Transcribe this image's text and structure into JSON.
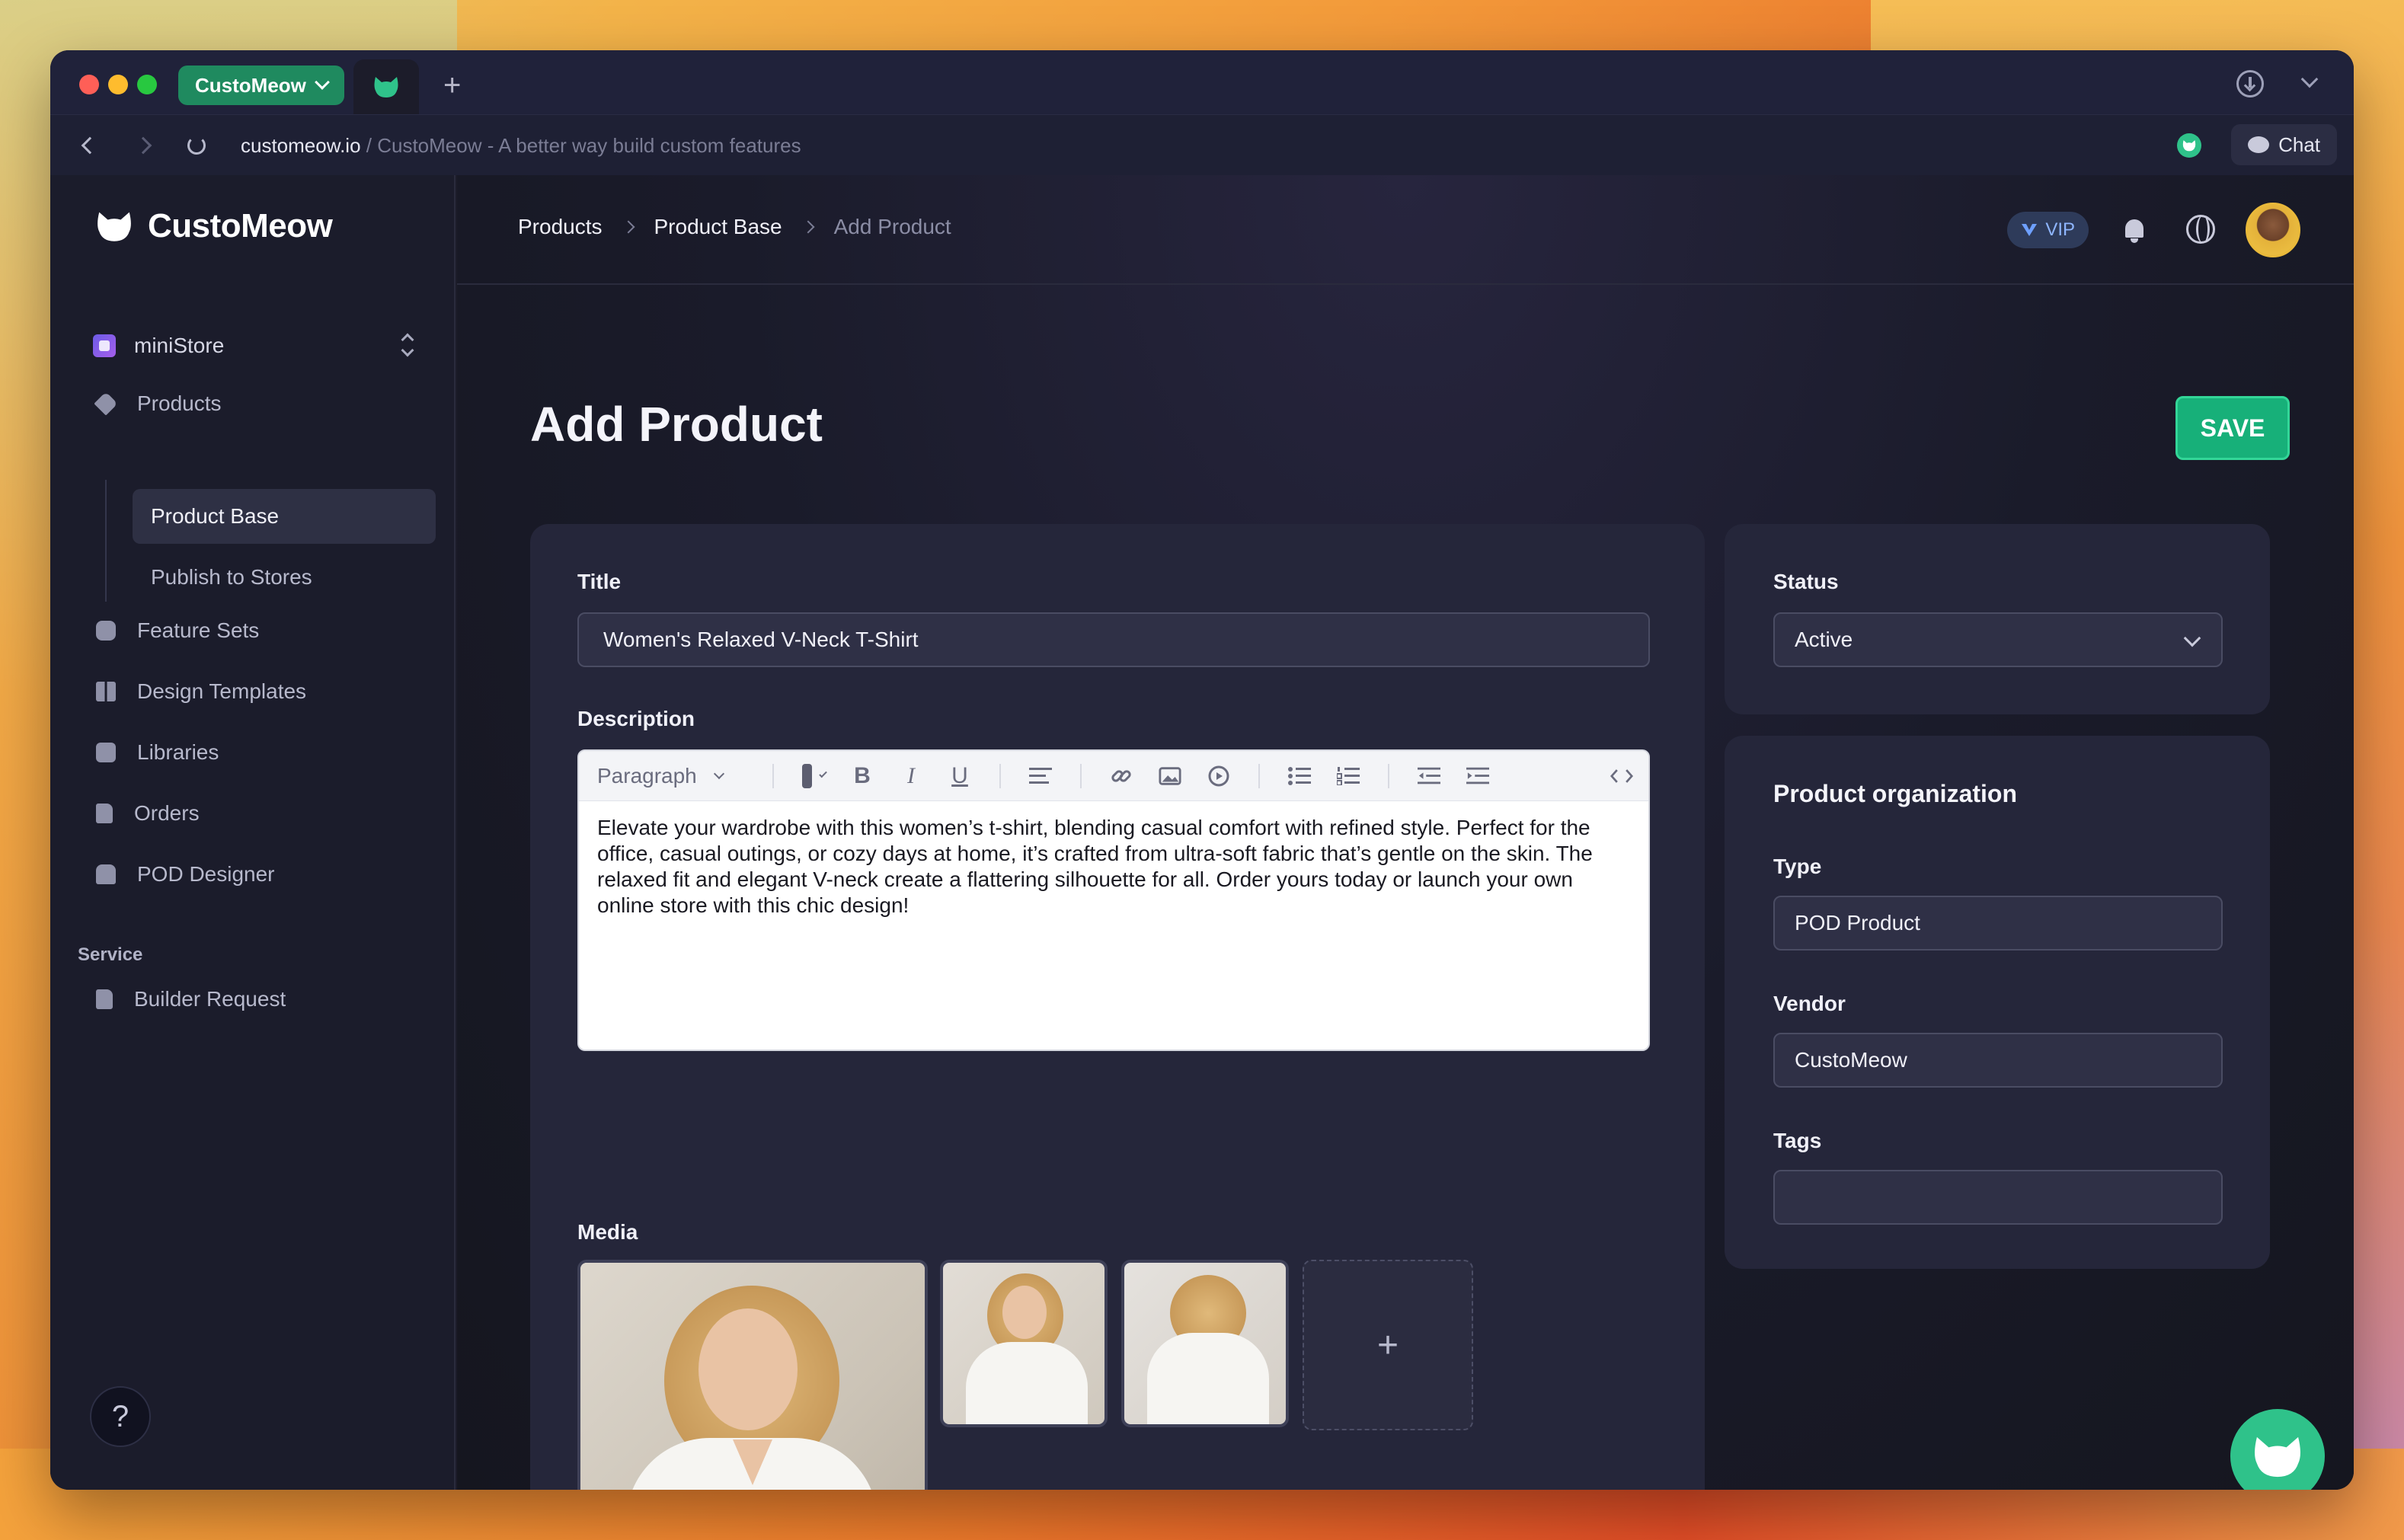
{
  "browser": {
    "app_tab_label": "CustoMeow",
    "url_domain": "customeow.io",
    "url_rest": " / CustoMeow - A better way build custom features",
    "chat_label": "Chat"
  },
  "sidebar": {
    "brand": "CustoMeow",
    "store": "miniStore",
    "items": [
      {
        "label": "Products",
        "icon": "tag-icon"
      },
      {
        "label": "Product Base",
        "icon": ""
      },
      {
        "label": "Publish to Stores",
        "icon": ""
      },
      {
        "label": "Feature Sets",
        "icon": "puzzle-icon"
      },
      {
        "label": "Design Templates",
        "icon": "grid-icon"
      },
      {
        "label": "Libraries",
        "icon": "stack-icon"
      },
      {
        "label": "Orders",
        "icon": "document-icon"
      },
      {
        "label": "POD Designer",
        "icon": "shirt-icon"
      }
    ],
    "section_service": "Service",
    "service_items": [
      {
        "label": "Builder Request",
        "icon": "request-icon"
      }
    ],
    "help": "?"
  },
  "topbar": {
    "breadcrumb": [
      "Products",
      "Product Base",
      "Add Product"
    ],
    "vip_label": "VIP"
  },
  "page": {
    "title": "Add Product",
    "save_label": "SAVE"
  },
  "form": {
    "title_label": "Title",
    "title_value": "Women's Relaxed V-Neck T-Shirt",
    "description_label": "Description",
    "toolbar_paragraph": "Paragraph",
    "description_value": "Elevate your wardrobe with this women’s t-shirt, blending casual comfort with refined style. Perfect for the office, casual outings, or cozy days at home, it’s crafted from ultra-soft fabric that’s gentle on the skin. The relaxed fit and elegant V-neck create a flattering silhouette for all. Order yours today or launch your own online store with this chic design!",
    "media_label": "Media",
    "media_add": "+"
  },
  "status_card": {
    "label": "Status",
    "value": "Active"
  },
  "org_card": {
    "title": "Product organization",
    "type_label": "Type",
    "type_value": "POD Product",
    "vendor_label": "Vendor",
    "vendor_value": "CustoMeow",
    "tags_label": "Tags",
    "tags_value": ""
  },
  "colors": {
    "accent": "#17b079",
    "brand_green": "#2fc28a",
    "panel": "#25263a"
  }
}
